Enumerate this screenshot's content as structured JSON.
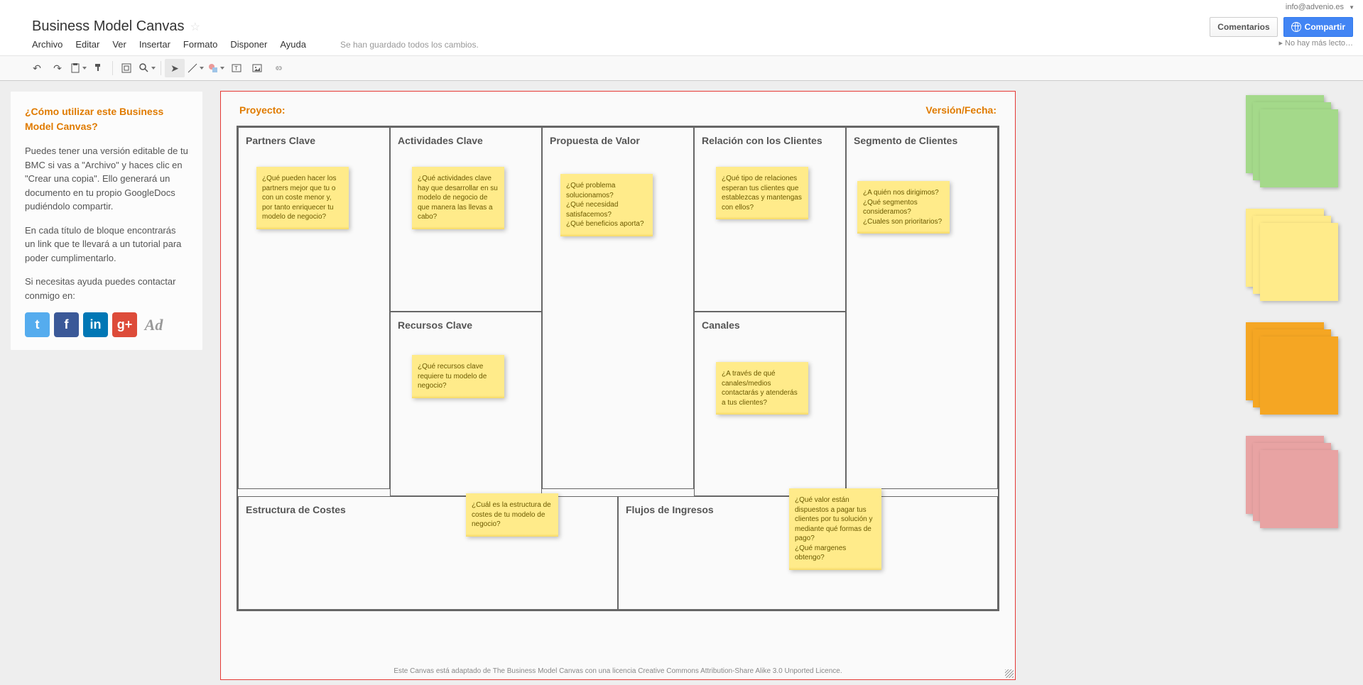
{
  "account": {
    "email": "info@advenio.es"
  },
  "title": "Business Model Canvas",
  "menu": [
    "Archivo",
    "Editar",
    "Ver",
    "Insertar",
    "Formato",
    "Disponer",
    "Ayuda"
  ],
  "saveStatus": "Se han guardado todos los cambios.",
  "headerButtons": {
    "comments": "Comentarios",
    "share": "Compartir"
  },
  "readers": "No hay más lecto…",
  "sidebar": {
    "title": "¿Cómo utilizar este Business Model Canvas?",
    "p1": "Puedes tener una versión editable de tu BMC si vas a \"Archivo\" y haces clic en \"Crear una copia\". Ello generará un documento en tu propio GoogleDocs pudiéndolo compartir.",
    "p2": "En cada título de bloque encontrarás un link que te llevará a un tutorial para poder cumplimentarlo.",
    "p3": "Si necesitas ayuda puedes contactar conmigo en:",
    "ad": "Ad"
  },
  "canvas": {
    "project": "Proyecto:",
    "version": "Versión/Fecha:",
    "blocks": {
      "partners": "Partners Clave",
      "activities": "Actividades Clave",
      "value": "Propuesta de Valor",
      "relations": "Relación con los Clientes",
      "segments": "Segmento de Clientes",
      "resources": "Recursos Clave",
      "channels": "Canales",
      "costs": "Estructura de Costes",
      "revenue": "Flujos de Ingresos"
    },
    "notes": {
      "partners": "¿Qué pueden hacer los partners mejor que tu o con un coste menor y, por tanto enriquecer tu modelo de negocio?",
      "activities": "¿Qué actividades clave hay que desarrollar en su modelo de negocio de que manera las llevas a cabo?",
      "value": "¿Qué problema solucionamos?\n¿Qué necesidad satisfacemos?\n¿Qué beneficios aporta?",
      "relations": "¿Qué tipo de relaciones esperan tus clientes que establezcas y mantengas con ellos?",
      "segments": "¿A quién nos dirigimos?\n¿Qué segmentos consideramos?\n¿Cuales son prioritarios?",
      "resources": "¿Qué recursos clave requiere tu modelo de negocio?",
      "channels": "¿A través de qué canales/medios contactarás y atenderás a tus clientes?",
      "costs": "¿Cuál es la estructura de costes de tu modelo de negocio?",
      "revenue": "¿Qué valor están dispuestos a pagar tus clientes por tu solución y mediante qué formas de pago?\n¿Qué margenes obtengo?"
    },
    "footer": "Este Canvas está adaptado de The Business Model Canvas con una licencia Creative Commons Attribution-Share Alike 3.0 Unported Licence."
  }
}
